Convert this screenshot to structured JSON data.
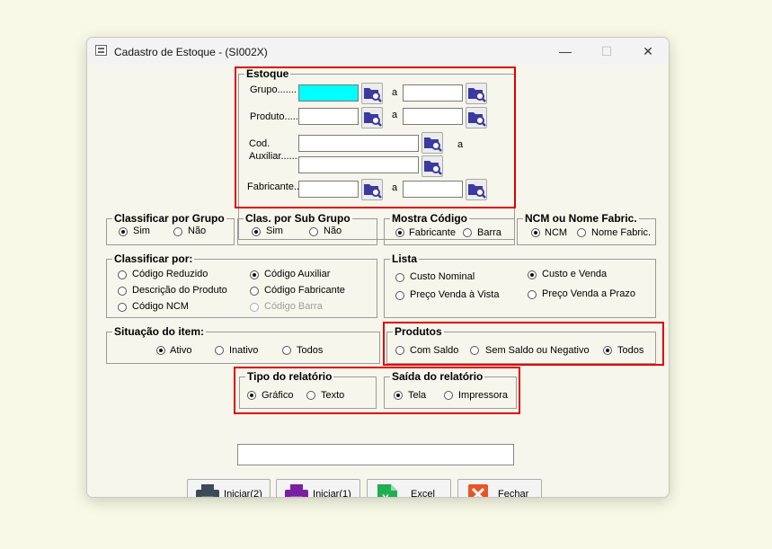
{
  "window": {
    "title": "Cadastro de Estoque - (SI002X)",
    "minimize_glyph": "—",
    "maximize_glyph": "☐",
    "close_glyph": "✕"
  },
  "estoque": {
    "legend": "Estoque",
    "grupo_label": "Grupo.......",
    "produto_label": "Produto......",
    "cod_label": "Cod.",
    "auxiliar_label": "Auxiliar.......",
    "fabricante_label": "Fabricante..",
    "a_label": "a",
    "grupo_from": "",
    "grupo_to": "",
    "produto_from": "",
    "produto_to": "",
    "cod_aux_1": "",
    "cod_aux_2": "",
    "fabricante_from": "",
    "fabricante_to": ""
  },
  "classificar_grupo": {
    "legend": "Classificar por Grupo",
    "sim": "Sim",
    "nao": "Não",
    "selected": "Sim"
  },
  "clas_sub_grupo": {
    "legend": "Clas. por Sub Grupo",
    "sim": "Sim",
    "nao": "Não",
    "selected": "Sim"
  },
  "mostra_codigo": {
    "legend": "Mostra Código",
    "fabricante": "Fabricante",
    "barra": "Barra",
    "selected": "Fabricante"
  },
  "ncm_nome": {
    "legend": "NCM ou Nome Fabric.",
    "ncm": "NCM",
    "nome": "Nome Fabric.",
    "selected": "NCM"
  },
  "classificar_por": {
    "legend": "Classificar por:",
    "codigo_reduzido": "Código Reduzido",
    "descricao_produto": "Descrição do Produto",
    "codigo_ncm": "Código NCM",
    "codigo_auxiliar": "Código Auxiliar",
    "codigo_fabricante": "Código Fabricante",
    "codigo_barra": "Código Barra",
    "selected": "Código Auxiliar"
  },
  "lista": {
    "legend": "Lista",
    "custo_nominal": "Custo Nominal",
    "preco_vista": "Preço Venda à Vista",
    "custo_venda": "Custo e Venda",
    "preco_prazo": "Preço Venda a Prazo",
    "selected": "Custo e Venda"
  },
  "situacao": {
    "legend": "Situação do item:",
    "ativo": "Ativo",
    "inativo": "Inativo",
    "todos": "Todos",
    "selected": "Ativo"
  },
  "produtos": {
    "legend": "Produtos",
    "com_saldo": "Com Saldo",
    "sem_saldo": "Sem Saldo ou Negativo",
    "todos": "Todos",
    "selected": "Todos"
  },
  "tipo_relatorio": {
    "legend": "Tipo do relatório",
    "grafico": "Gráfico",
    "texto": "Texto",
    "selected": "Gráfico"
  },
  "saida_relatorio": {
    "legend": "Saída do relatório",
    "tela": "Tela",
    "impressora": "Impressora",
    "selected": "Tela"
  },
  "status_text": "",
  "buttons": {
    "iniciar2": "Iniciar(2)",
    "iniciar1": "Iniciar(1)",
    "excel": "Excel",
    "fechar": "Fechar"
  },
  "colors": {
    "focus_input": "#00ffff",
    "highlight_border": "#e00000",
    "search_icon": "#3a3aa0",
    "printer_dark": "#3c4a5a",
    "printer_purple": "#7b1fa2",
    "excel_green": "#1fae52",
    "close_red": "#e8552a"
  }
}
